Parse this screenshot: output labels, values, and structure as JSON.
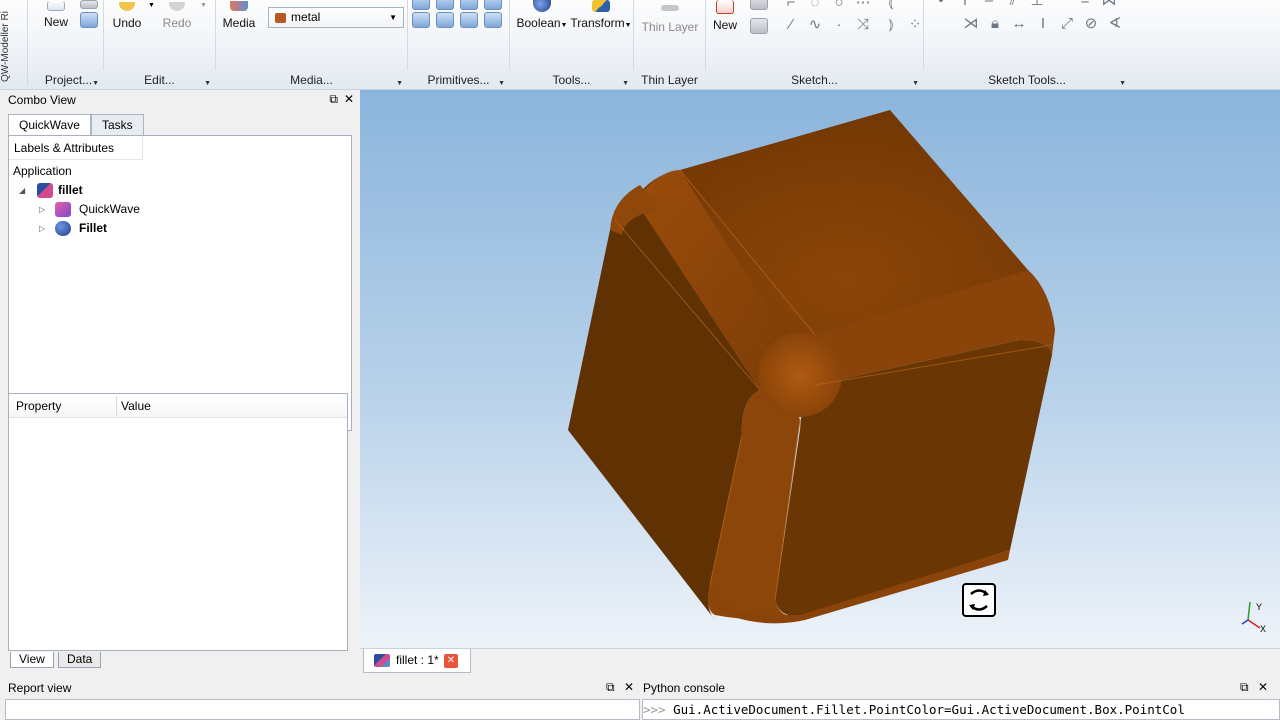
{
  "ribbon": {
    "vertical_title": "QW-Modeller Ri",
    "buttons": {
      "new": "New",
      "undo": "Undo",
      "redo": "Redo",
      "media": "Media",
      "boolean": "Boolean",
      "transform": "Transform",
      "thin_layer": "Thin Layer",
      "sketch_new": "New"
    },
    "material_combo": "metal",
    "groups": {
      "project": "Project...",
      "edit": "Edit...",
      "media": "Media...",
      "primitives": "Primitives...",
      "tools": "Tools...",
      "thin_layer": "Thin Layer",
      "sketch": "Sketch...",
      "sketch_tools": "Sketch Tools..."
    }
  },
  "combo_view": {
    "title": "Combo View",
    "tabs": [
      "QuickWave",
      "Tasks"
    ],
    "tree_header": "Labels & Attributes",
    "tree": {
      "root": "Application",
      "document": "fillet",
      "children": [
        "QuickWave",
        "Fillet"
      ]
    },
    "property_header": {
      "property": "Property",
      "value": "Value"
    },
    "bottom_tabs": [
      "View",
      "Data"
    ]
  },
  "document_tab": {
    "label": "fillet : 1*"
  },
  "report_view": {
    "title": "Report view"
  },
  "python_console": {
    "title": "Python console",
    "prompt": ">>>",
    "line": "Gui.ActiveDocument.Fillet.PointColor=Gui.ActiveDocument.Box.PointCol"
  },
  "axis": {
    "y": "Y",
    "x": "X"
  },
  "colors": {
    "model": "#7a3d06",
    "accent": "#2c5aa0"
  }
}
